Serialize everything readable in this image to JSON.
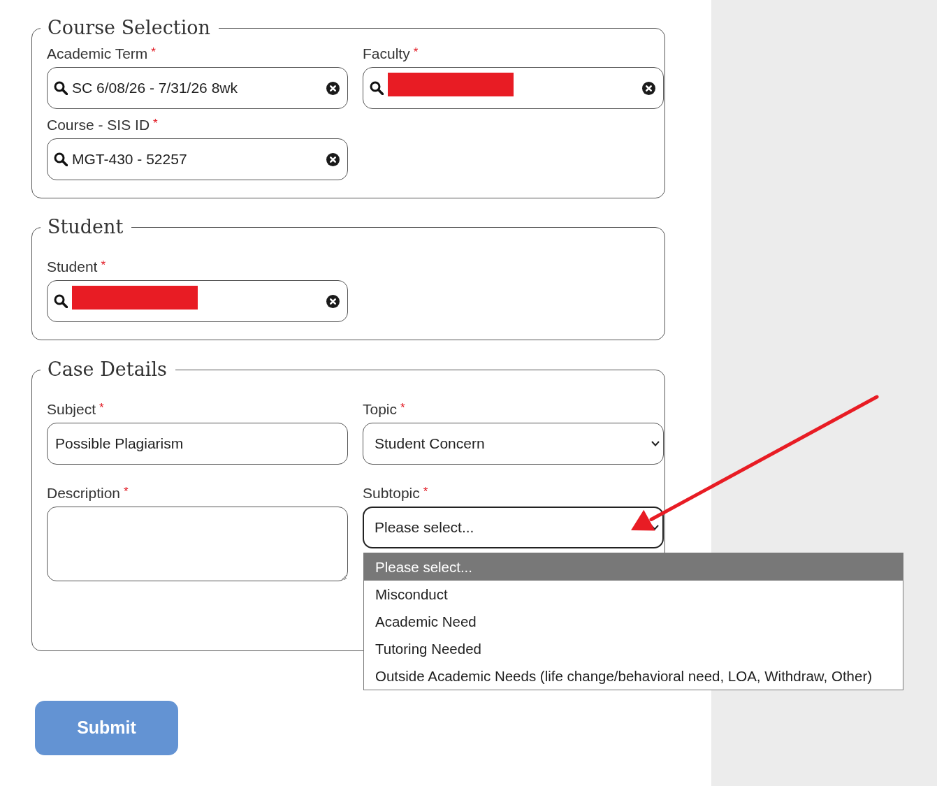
{
  "sections": [
    {
      "title": "Course Selection",
      "fields": [
        {
          "kind": "search",
          "label": "Academic Term",
          "required_mark": "*",
          "value": "SC 6/08/26 - 7/31/26 8wk",
          "redacted": false
        },
        {
          "kind": "search",
          "label": "Faculty",
          "required_mark": "*",
          "redacted": true
        },
        {
          "kind": "search",
          "label": "Course - SIS ID",
          "required_mark": "*",
          "value": "MGT-430 - 52257",
          "redacted": false
        }
      ]
    },
    {
      "title": "Student",
      "fields": [
        {
          "kind": "search",
          "label": "Student",
          "required_mark": "*",
          "redacted": true
        }
      ]
    },
    {
      "title": "Case Details",
      "fields": [
        {
          "kind": "text",
          "label": "Subject",
          "required_mark": "*",
          "value": "Possible Plagiarism"
        },
        {
          "kind": "select",
          "label": "Topic",
          "required_mark": "*",
          "value": "Student Concern",
          "expanded": false
        },
        {
          "kind": "textarea",
          "label": "Description",
          "required_mark": "*"
        },
        {
          "kind": "select",
          "label": "Subtopic",
          "required_mark": "*",
          "value": "Please select...",
          "expanded": true,
          "options": [
            {
              "label": "Please select...",
              "selected": true
            },
            {
              "label": "Misconduct",
              "selected": false
            },
            {
              "label": "Academic Need",
              "selected": false
            },
            {
              "label": "Tutoring Needed",
              "selected": false
            },
            {
              "label": "Outside Academic Needs (life change/behavioral need, LOA, Withdraw, Other)",
              "selected": false
            }
          ]
        }
      ]
    }
  ],
  "submit_button": {
    "label": "Submit"
  },
  "annotations": [
    {
      "kind": "arrow"
    }
  ]
}
